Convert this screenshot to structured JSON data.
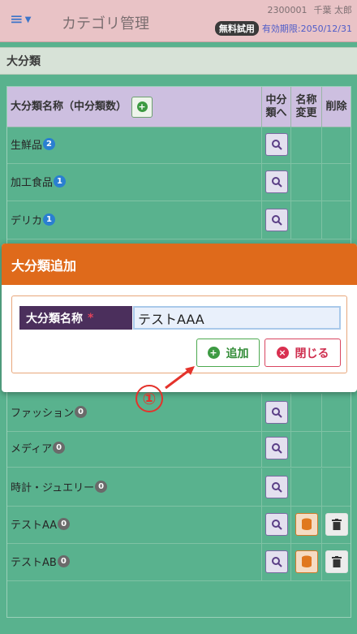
{
  "header": {
    "menu_icon": "hamburger-icon",
    "title": "カテゴリ管理",
    "user_id": "2300001",
    "user_name": "千葉 太郎",
    "trial_badge": "無料試用",
    "expiry": "有効期限:2050/12/31"
  },
  "section": {
    "title": "大分類"
  },
  "table": {
    "headers": {
      "name": "大分類名称（中分類数）",
      "to_sub": "中分\n類へ",
      "rename": "名称\n変更",
      "delete": "削除"
    },
    "rows": [
      {
        "name": "生鮮品",
        "count": "2",
        "has_rename": false,
        "has_delete": false
      },
      {
        "name": "加工食品",
        "count": "1",
        "has_rename": false,
        "has_delete": false
      },
      {
        "name": "デリカ",
        "count": "1",
        "has_rename": false,
        "has_delete": false
      },
      {
        "name": "ファッション",
        "count": "0",
        "has_rename": false,
        "has_delete": false
      },
      {
        "name": "メディア",
        "count": "0",
        "has_rename": false,
        "has_delete": false
      },
      {
        "name": "時計・ジュエリー",
        "count": "0",
        "has_rename": false,
        "has_delete": false
      },
      {
        "name": "テストAA",
        "count": "0",
        "has_rename": true,
        "has_delete": true
      },
      {
        "name": "テストAB",
        "count": "0",
        "has_rename": true,
        "has_delete": true
      }
    ]
  },
  "modal": {
    "title": "大分類追加",
    "field_label": "大分類名称",
    "required_mark": "*",
    "field_value": "テストAAA",
    "add_label": "追加",
    "close_label": "閉じる"
  },
  "annotation": {
    "step": "①"
  },
  "colors": {
    "background": "#59b28e",
    "header": "#e9c3c6",
    "modal_header": "#df6a1b",
    "add_green": "#3d9a43",
    "close_red": "#d93050"
  }
}
